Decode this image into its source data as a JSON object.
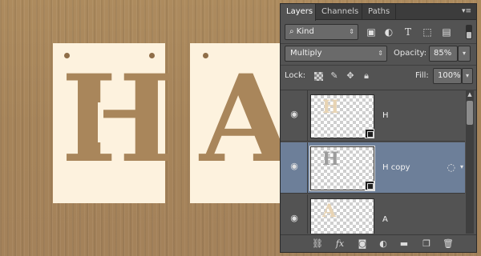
{
  "canvas": {
    "card_h_letter": "H",
    "card_a_letter": "A",
    "card_color": "#fdf2de",
    "background_color": "#a9875a"
  },
  "panel": {
    "tabs": [
      {
        "label": "Layers",
        "active": true
      },
      {
        "label": "Channels",
        "active": false
      },
      {
        "label": "Paths",
        "active": false
      }
    ],
    "menu_icon": "panel-menu-icon",
    "filter": {
      "kind_label": "Kind",
      "icons": [
        "image-filter-icon",
        "adjustment-filter-icon",
        "type-filter-icon",
        "shape-filter-icon",
        "smart-object-filter-icon"
      ]
    },
    "blend_mode": "Multiply",
    "opacity_label": "Opacity:",
    "opacity_value": "85%",
    "lock_label": "Lock:",
    "fill_label": "Fill:",
    "fill_value": "100%",
    "layers": [
      {
        "name": "H",
        "selected": false,
        "thumb_letter": "H",
        "has_fx": false
      },
      {
        "name": "H copy",
        "selected": true,
        "thumb_letter": "H",
        "has_fx": true
      },
      {
        "name": "A",
        "selected": false,
        "thumb_letter": "A",
        "has_fx": false
      }
    ],
    "footer_icons": [
      "link-icon",
      "fx-icon",
      "mask-icon",
      "adjustment-icon",
      "folder-icon",
      "new-layer-icon",
      "trash-icon"
    ],
    "footer_fx_text": "fx"
  }
}
